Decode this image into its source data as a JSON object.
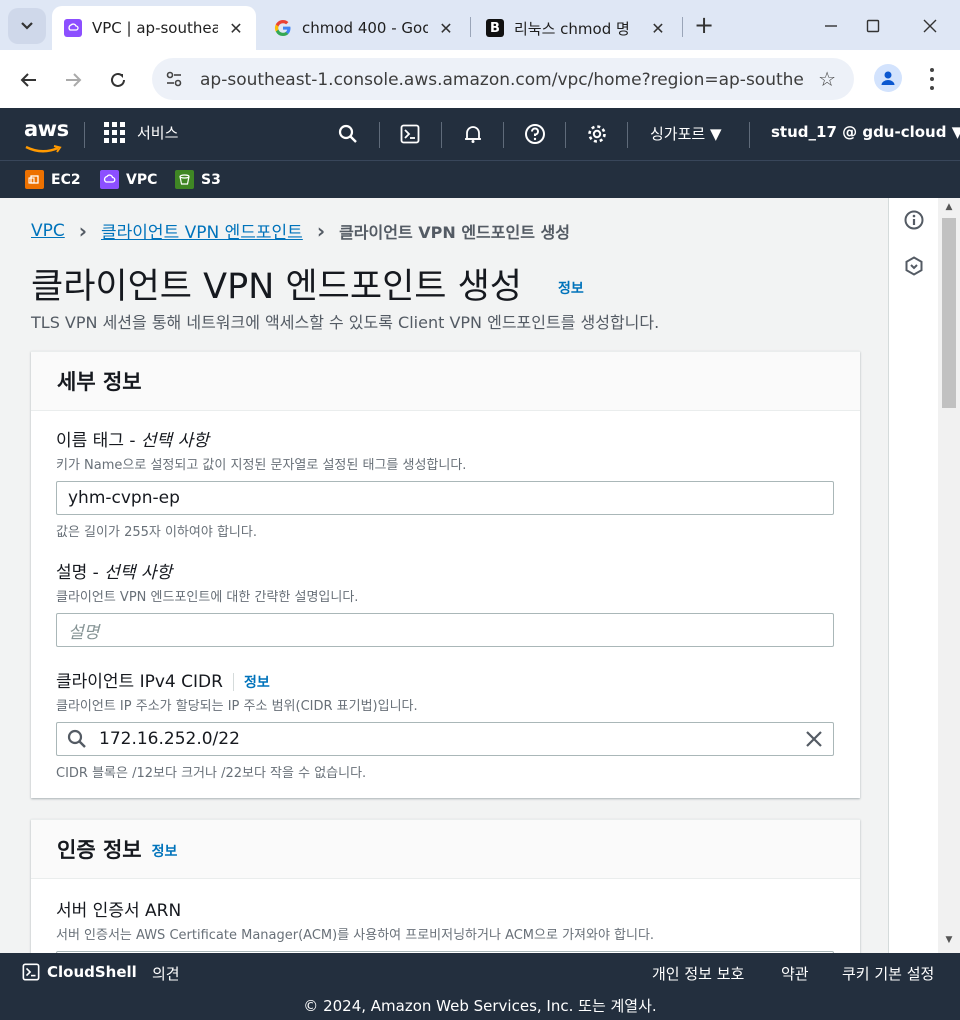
{
  "browser": {
    "tabs": [
      {
        "title": "VPC | ap-southeast",
        "icon": "aws-vpc-favicon"
      },
      {
        "title": "chmod 400 - Goo",
        "icon": "google-favicon"
      },
      {
        "title": "리눅스 chmod 명",
        "icon": "b-favicon"
      }
    ],
    "new_tab": "+",
    "url": "ap-southeast-1.console.aws.amazon.com/vpc/home?region=ap-southeast-..."
  },
  "aws_header": {
    "logo": "aws",
    "services": "서비스",
    "region": "싱가포르 ▼",
    "account": "stud_17 @ gdu-cloud ▼"
  },
  "favorites": [
    {
      "label": "EC2",
      "color": "#ed7100"
    },
    {
      "label": "VPC",
      "color": "#8c4fff"
    },
    {
      "label": "S3",
      "color": "#3f8624"
    }
  ],
  "breadcrumb": {
    "root": "VPC",
    "parent": "클라이언트 VPN 엔드포인트",
    "current": "클라이언트 VPN 엔드포인트 생성"
  },
  "page": {
    "title": "클라이언트 VPN 엔드포인트 생성",
    "info": "정보",
    "description": "TLS VPN 세션을 통해 네트워크에 액세스할 수 있도록 Client VPN 엔드포인트를 생성합니다."
  },
  "details": {
    "heading": "세부 정보",
    "name_tag": {
      "label": "이름 태그 - ",
      "optional": "선택 사항",
      "description": "키가 Name으로 설정되고 값이 지정된 문자열로 설정된 태그를 생성합니다.",
      "value": "yhm-cvpn-ep",
      "constraint": "값은 길이가 255자 이하여야 합니다."
    },
    "description_field": {
      "label": "설명 - ",
      "optional": "선택 사항",
      "description": "클라이언트 VPN 엔드포인트에 대한 간략한 설명입니다.",
      "placeholder": "설명"
    },
    "client_cidr": {
      "label": "클라이언트 IPv4 CIDR",
      "info": "정보",
      "description": "클라이언트 IP 주소가 할당되는 IP 주소 범위(CIDR 표기법)입니다.",
      "value": "172.16.252.0/22",
      "constraint": "CIDR 블록은 /12보다 크거나 /22보다 작을 수 없습니다."
    }
  },
  "auth": {
    "heading": "인증 정보",
    "info": "정보",
    "server_cert": {
      "label": "서버 인증서 ARN",
      "description": "서버 인증서는 AWS Certificate Manager(ACM)를 사용하여 프로비저닝하거나 ACM으로 가져와야 합니다."
    }
  },
  "footer": {
    "cloudshell": "CloudShell",
    "feedback": "의견",
    "privacy": "개인 정보 보호",
    "terms": "약관",
    "cookies": "쿠키 기본 설정",
    "copyright": "© 2024, Amazon Web Services, Inc. 또는 계열사."
  }
}
